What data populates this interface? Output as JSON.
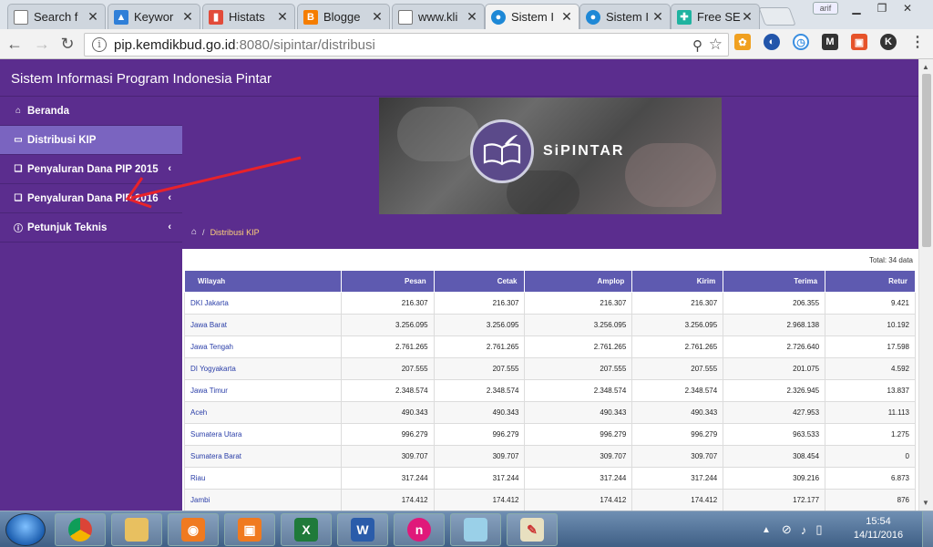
{
  "browser": {
    "tabs": [
      {
        "title": "Search f",
        "icon": "page-icon"
      },
      {
        "title": "Keywor",
        "icon": "adwords-icon"
      },
      {
        "title": "Histats",
        "icon": "histats-icon"
      },
      {
        "title": "Blogge",
        "icon": "blogger-icon"
      },
      {
        "title": "www.kli",
        "icon": "page-icon"
      },
      {
        "title": "Sistem I",
        "icon": "kemdikbud-icon"
      },
      {
        "title": "Sistem I",
        "icon": "kemdikbud-icon"
      },
      {
        "title": "Free SE",
        "icon": "plus-icon"
      }
    ],
    "user_badge": "arif",
    "url_host": "pip.kemdikbud.go.id",
    "url_path": ":8080/sipintar/distribusi"
  },
  "site": {
    "title": "Sistem Informasi Program Indonesia Pintar",
    "logo_text": "SiPINTAR",
    "breadcrumb_current": "Distribusi KIP",
    "accent_color": "#5b2d8e",
    "table_header_color": "#5e5ab0"
  },
  "sidebar": {
    "items": [
      {
        "label": "Beranda",
        "icon": "home-icon",
        "active": false,
        "expandable": false
      },
      {
        "label": "Distribusi KIP",
        "icon": "card-icon",
        "active": true,
        "expandable": false
      },
      {
        "label": "Penyaluran Dana PIP 2015",
        "icon": "copy-icon",
        "active": false,
        "expandable": true
      },
      {
        "label": "Penyaluran Dana PIP 2016",
        "icon": "copy-icon",
        "active": false,
        "expandable": true
      },
      {
        "label": "Petunjuk Teknis",
        "icon": "info-icon",
        "active": false,
        "expandable": true
      }
    ]
  },
  "table": {
    "total_label": "Total: 34 data",
    "headers": [
      "Wilayah",
      "Pesan",
      "Cetak",
      "Amplop",
      "Kirim",
      "Terima",
      "Retur"
    ],
    "rows": [
      [
        "DKI Jakarta",
        "216.307",
        "216.307",
        "216.307",
        "216.307",
        "206.355",
        "9.421"
      ],
      [
        "Jawa Barat",
        "3.256.095",
        "3.256.095",
        "3.256.095",
        "3.256.095",
        "2.968.138",
        "10.192"
      ],
      [
        "Jawa Tengah",
        "2.761.265",
        "2.761.265",
        "2.761.265",
        "2.761.265",
        "2.726.640",
        "17.598"
      ],
      [
        "DI Yogyakarta",
        "207.555",
        "207.555",
        "207.555",
        "207.555",
        "201.075",
        "4.592"
      ],
      [
        "Jawa Timur",
        "2.348.574",
        "2.348.574",
        "2.348.574",
        "2.348.574",
        "2.326.945",
        "13.837"
      ],
      [
        "Aceh",
        "490.343",
        "490.343",
        "490.343",
        "490.343",
        "427.953",
        "11.113"
      ],
      [
        "Sumatera Utara",
        "996.279",
        "996.279",
        "996.279",
        "996.279",
        "963.533",
        "1.275"
      ],
      [
        "Sumatera Barat",
        "309.707",
        "309.707",
        "309.707",
        "309.707",
        "308.454",
        "0"
      ],
      [
        "Riau",
        "317.244",
        "317.244",
        "317.244",
        "317.244",
        "309.216",
        "6.873"
      ],
      [
        "Jambi",
        "174.412",
        "174.412",
        "174.412",
        "174.412",
        "172.177",
        "876"
      ]
    ]
  },
  "taskbar": {
    "apps": [
      "chrome-icon",
      "explorer-icon",
      "screenshot-icon",
      "camera-icon",
      "excel-icon",
      "word-icon",
      "app-n-icon",
      "notepad-icon",
      "paint-icon"
    ],
    "time": "15:54",
    "date": "14/11/2016"
  }
}
